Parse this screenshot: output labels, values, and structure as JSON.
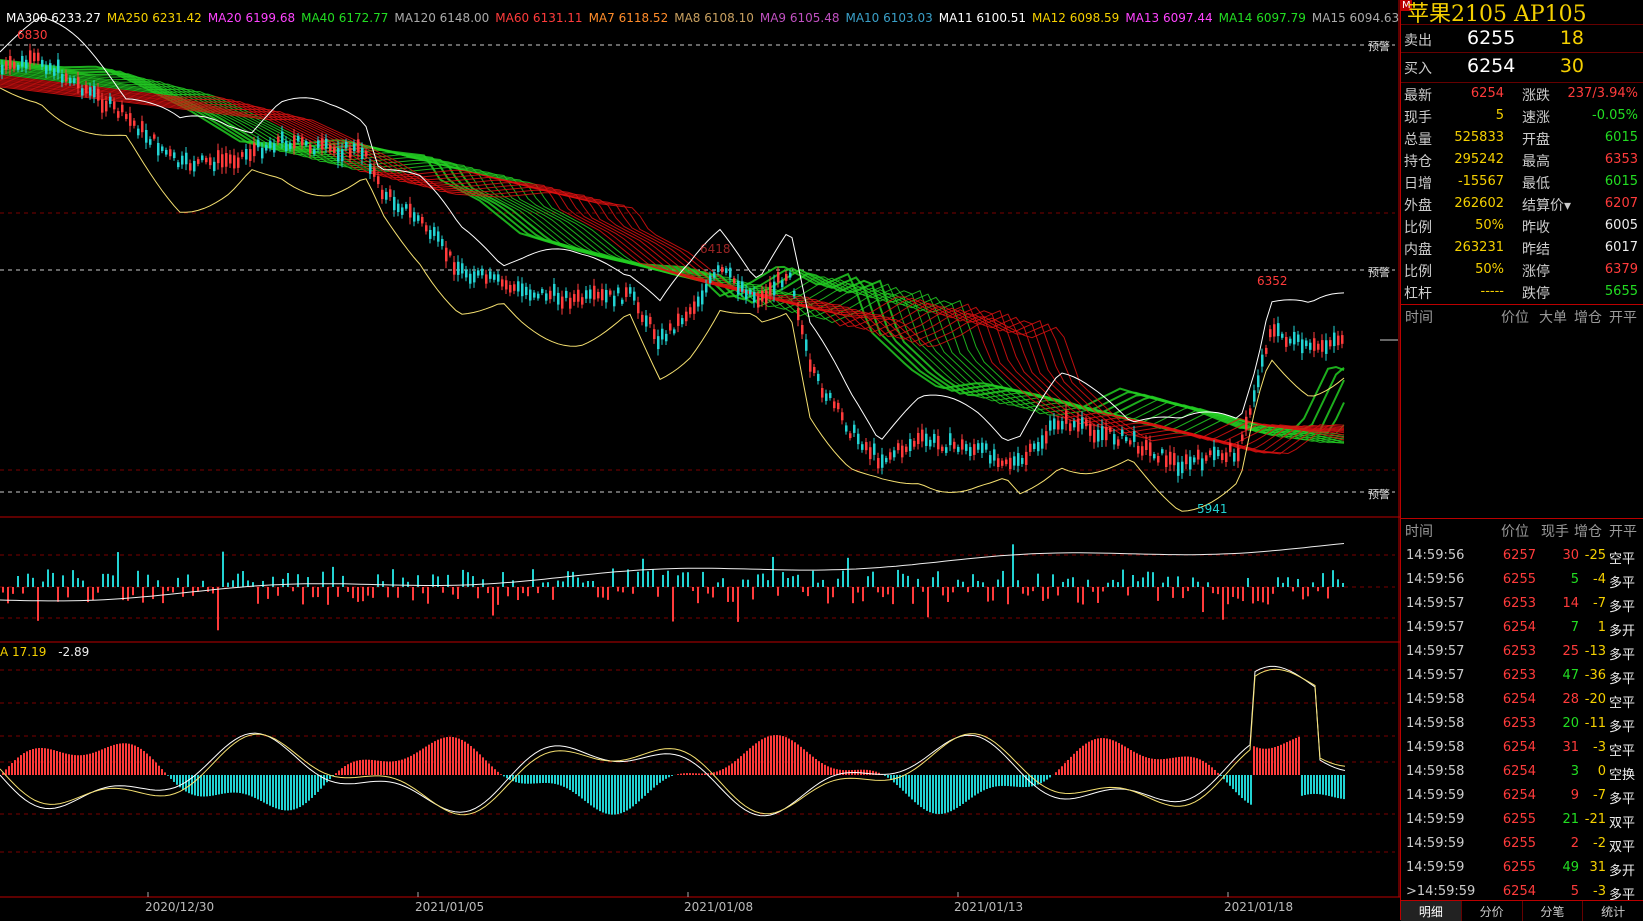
{
  "ma_legend": [
    {
      "label": "MA300 6233.27",
      "color": "#ffffff"
    },
    {
      "label": "MA250 6231.42",
      "color": "#f5d000"
    },
    {
      "label": "MA20 6199.68",
      "color": "#ff44ff"
    },
    {
      "label": "MA40 6172.77",
      "color": "#22dd22"
    },
    {
      "label": "MA120 6148.00",
      "color": "#aaaaaa"
    },
    {
      "label": "MA60 6131.11",
      "color": "#ff3b3b"
    },
    {
      "label": "MA7 6118.52",
      "color": "#ff8c2a"
    },
    {
      "label": "MA8 6108.10",
      "color": "#c8a060"
    },
    {
      "label": "MA9 6105.48",
      "color": "#c050c0"
    },
    {
      "label": "MA10 6103.03",
      "color": "#3aa0c8"
    },
    {
      "label": "MA11 6100.51",
      "color": "#ffffff"
    },
    {
      "label": "MA12 6098.59",
      "color": "#f5d000"
    },
    {
      "label": "MA13 6097.44",
      "color": "#ff44ff"
    },
    {
      "label": "MA14 6097.79",
      "color": "#22dd22"
    },
    {
      "label": "MA15 6094.63",
      "color": "#aaaaaa"
    }
  ],
  "price_labels": {
    "high_left": "6830",
    "mid_high": "6418",
    "recent_high": "6352",
    "recent_low": "5941",
    "warn": "预警"
  },
  "macd_legend": {
    "a": "A 17.19",
    "b": "-2.89"
  },
  "x_axis": [
    "2020/12/30",
    "2021/01/05",
    "2021/01/08",
    "2021/01/13",
    "2021/01/18"
  ],
  "panel": {
    "marker": "M",
    "title": "苹果2105  AP105",
    "sell": {
      "label": "卖出",
      "price": "6255",
      "vol": "18"
    },
    "buy": {
      "label": "买入",
      "price": "6254",
      "vol": "30"
    },
    "stats": [
      {
        "l1": "最新",
        "v1": "6254",
        "c1": "red",
        "l2": "涨跌",
        "v2": "237/3.94%",
        "c2": "red"
      },
      {
        "l1": "现手",
        "v1": "5",
        "c1": "yellow",
        "l2": "速涨",
        "v2": "-0.05%",
        "c2": "green"
      },
      {
        "l1": "总量",
        "v1": "525833",
        "c1": "yellow",
        "l2": "开盘",
        "v2": "6015",
        "c2": "green"
      },
      {
        "l1": "持仓",
        "v1": "295242",
        "c1": "yellow",
        "l2": "最高",
        "v2": "6353",
        "c2": "red"
      },
      {
        "l1": "日增",
        "v1": "-15567",
        "c1": "yellow",
        "l2": "最低",
        "v2": "6015",
        "c2": "green"
      },
      {
        "l1": "外盘",
        "v1": "262602",
        "c1": "yellow",
        "l2": "结算价▾",
        "v2": "6207",
        "c2": "red"
      },
      {
        "l1": "比例",
        "v1": "50%",
        "c1": "yellow",
        "l2": "昨收",
        "v2": "6005",
        "c2": "white"
      },
      {
        "l1": "内盘",
        "v1": "263231",
        "c1": "yellow",
        "l2": "昨结",
        "v2": "6017",
        "c2": "white"
      },
      {
        "l1": "比例",
        "v1": "50%",
        "c1": "yellow",
        "l2": "涨停",
        "v2": "6379",
        "c2": "red"
      },
      {
        "l1": "杠杆",
        "v1": "-----",
        "c1": "yellow",
        "l2": "跌停",
        "v2": "5655",
        "c2": "green"
      }
    ],
    "head1": {
      "time": "时间",
      "price": "价位",
      "big": "大单",
      "oi": "增仓",
      "type": "开平"
    },
    "head2": {
      "time": "时间",
      "price": "价位",
      "qty": "现手",
      "oi": "增仓",
      "type": "开平"
    },
    "trades": [
      {
        "time": "14:59:56",
        "price": "6257",
        "qty": "30",
        "oi": "-25",
        "type": "空平"
      },
      {
        "time": "14:59:56",
        "price": "6255",
        "qty": "5",
        "oi": "-4",
        "type": "多平"
      },
      {
        "time": "14:59:57",
        "price": "6253",
        "qty": "14",
        "oi": "-7",
        "type": "多平"
      },
      {
        "time": "14:59:57",
        "price": "6254",
        "qty": "7",
        "oi": "1",
        "type": "多开"
      },
      {
        "time": "14:59:57",
        "price": "6253",
        "qty": "25",
        "oi": "-13",
        "type": "多平"
      },
      {
        "time": "14:59:57",
        "price": "6253",
        "qty": "47",
        "oi": "-36",
        "type": "多平"
      },
      {
        "time": "14:59:58",
        "price": "6254",
        "qty": "28",
        "oi": "-20",
        "type": "空平"
      },
      {
        "time": "14:59:58",
        "price": "6253",
        "qty": "20",
        "oi": "-11",
        "type": "多平"
      },
      {
        "time": "14:59:58",
        "price": "6254",
        "qty": "31",
        "oi": "-3",
        "type": "空平"
      },
      {
        "time": "14:59:58",
        "price": "6254",
        "qty": "3",
        "oi": "0",
        "type": "空换"
      },
      {
        "time": "14:59:59",
        "price": "6254",
        "qty": "9",
        "oi": "-7",
        "type": "多平"
      },
      {
        "time": "14:59:59",
        "price": "6255",
        "qty": "21",
        "oi": "-21",
        "type": "双平"
      },
      {
        "time": "14:59:59",
        "price": "6255",
        "qty": "2",
        "oi": "-2",
        "type": "双平"
      },
      {
        "time": "14:59:59",
        "price": "6255",
        "qty": "49",
        "oi": "31",
        "type": "多开"
      },
      {
        "time": "14:59:59",
        "price": "6254",
        "qty": "5",
        "oi": "-3",
        "type": "多平"
      }
    ],
    "tabs": [
      "明细",
      "分价",
      "分笔",
      "统计"
    ]
  },
  "colors": {
    "up": "#ff3b3b",
    "down": "#22d3d3",
    "ribbon_green": "#22cc22",
    "ribbon_red": "#dd1111",
    "grid": "#7a0000"
  }
}
